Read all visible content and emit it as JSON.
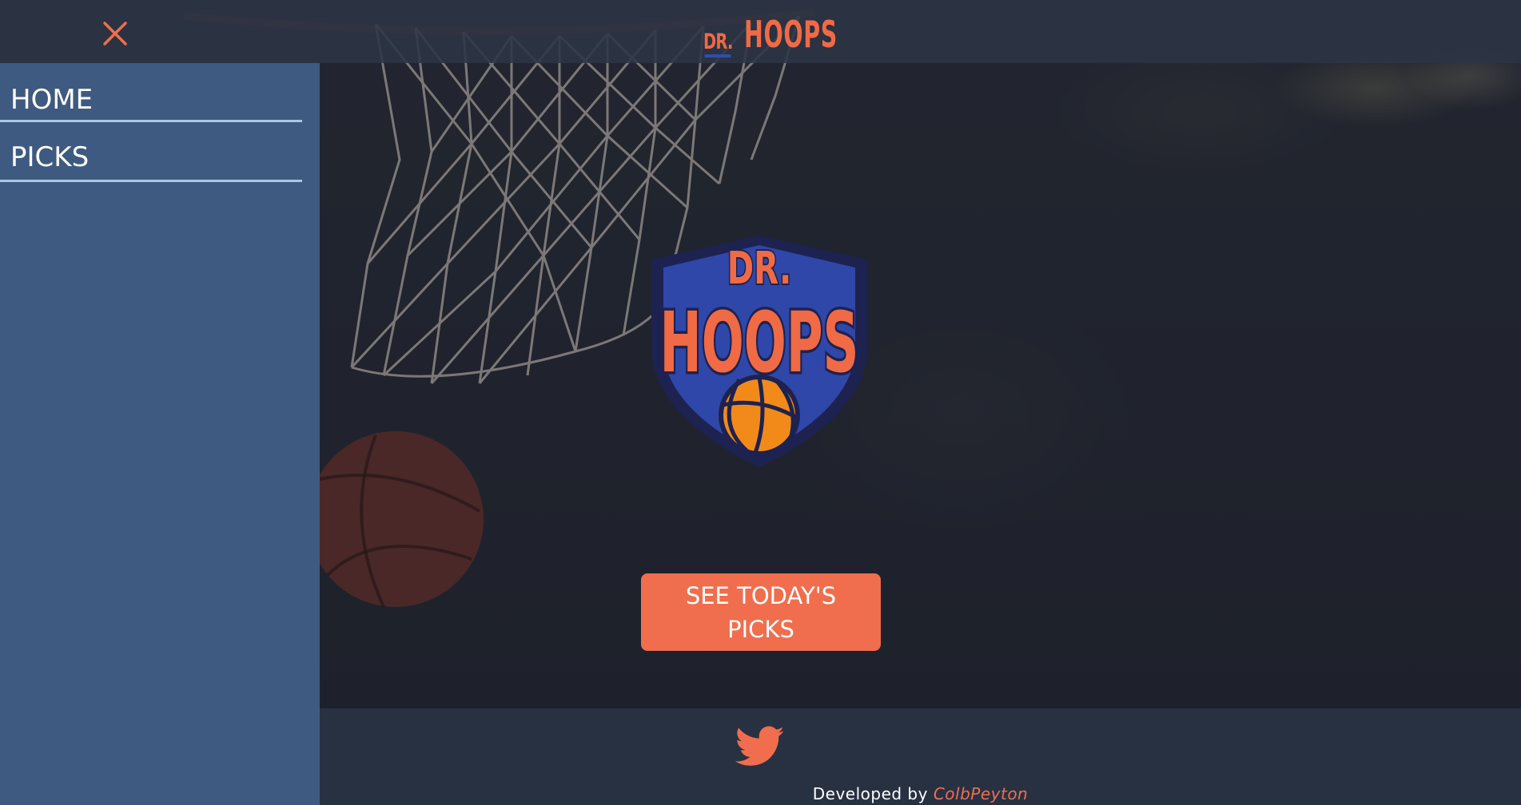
{
  "header": {
    "close_icon": "close-icon",
    "logo_dr": "DR.",
    "logo_hoops": "HOOPS"
  },
  "sidebar": {
    "items": [
      {
        "label": "HOME"
      },
      {
        "label": "PICKS"
      }
    ]
  },
  "hero": {
    "logo_dr": "DR.",
    "logo_hoops": "HOOPS",
    "cta_line1": "SEE TODAY'S",
    "cta_line2": "PICKS"
  },
  "footer": {
    "social_icon": "twitter-icon",
    "credit_prefix": "Developed by ",
    "credit_author": "ColbPeyton"
  },
  "colors": {
    "accent": "#f06e4d",
    "sidebar": "#3e5a80",
    "nav_underline": "#a9c6e6",
    "footer": "#283142",
    "logo_blue": "#2e4ea8"
  }
}
